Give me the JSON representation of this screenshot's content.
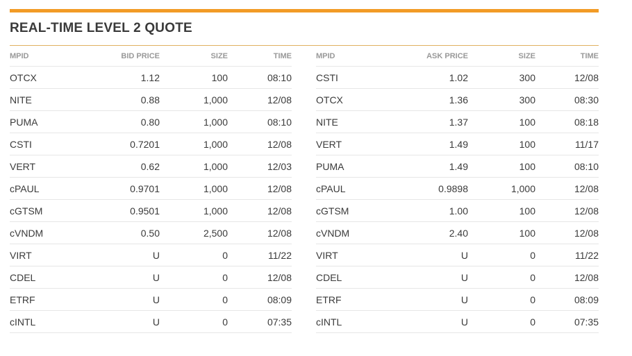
{
  "title": "REAL-TIME LEVEL 2 QUOTE",
  "colors": {
    "accent": "#f29b26",
    "rule": "#e0b060",
    "header_text": "#999999",
    "body_text": "#3a3a3a",
    "row_border": "#e6e6e6"
  },
  "bid": {
    "columns": [
      "MPID",
      "BID PRICE",
      "SIZE",
      "TIME"
    ],
    "rows": [
      {
        "mpid": "OTCX",
        "price": "1.12",
        "size": "100",
        "time": "08:10"
      },
      {
        "mpid": "NITE",
        "price": "0.88",
        "size": "1,000",
        "time": "12/08"
      },
      {
        "mpid": "PUMA",
        "price": "0.80",
        "size": "1,000",
        "time": "08:10"
      },
      {
        "mpid": "CSTI",
        "price": "0.7201",
        "size": "1,000",
        "time": "12/08"
      },
      {
        "mpid": "VERT",
        "price": "0.62",
        "size": "1,000",
        "time": "12/03"
      },
      {
        "mpid": "cPAUL",
        "price": "0.9701",
        "size": "1,000",
        "time": "12/08"
      },
      {
        "mpid": "cGTSM",
        "price": "0.9501",
        "size": "1,000",
        "time": "12/08"
      },
      {
        "mpid": "cVNDM",
        "price": "0.50",
        "size": "2,500",
        "time": "12/08"
      },
      {
        "mpid": "VIRT",
        "price": "U",
        "size": "0",
        "time": "11/22"
      },
      {
        "mpid": "CDEL",
        "price": "U",
        "size": "0",
        "time": "12/08"
      },
      {
        "mpid": "ETRF",
        "price": "U",
        "size": "0",
        "time": "08:09"
      },
      {
        "mpid": "cINTL",
        "price": "U",
        "size": "0",
        "time": "07:35"
      }
    ]
  },
  "ask": {
    "columns": [
      "MPID",
      "ASK PRICE",
      "SIZE",
      "TIME"
    ],
    "rows": [
      {
        "mpid": "CSTI",
        "price": "1.02",
        "size": "300",
        "time": "12/08"
      },
      {
        "mpid": "OTCX",
        "price": "1.36",
        "size": "300",
        "time": "08:30"
      },
      {
        "mpid": "NITE",
        "price": "1.37",
        "size": "100",
        "time": "08:18"
      },
      {
        "mpid": "VERT",
        "price": "1.49",
        "size": "100",
        "time": "11/17"
      },
      {
        "mpid": "PUMA",
        "price": "1.49",
        "size": "100",
        "time": "08:10"
      },
      {
        "mpid": "cPAUL",
        "price": "0.9898",
        "size": "1,000",
        "time": "12/08"
      },
      {
        "mpid": "cGTSM",
        "price": "1.00",
        "size": "100",
        "time": "12/08"
      },
      {
        "mpid": "cVNDM",
        "price": "2.40",
        "size": "100",
        "time": "12/08"
      },
      {
        "mpid": "VIRT",
        "price": "U",
        "size": "0",
        "time": "11/22"
      },
      {
        "mpid": "CDEL",
        "price": "U",
        "size": "0",
        "time": "12/08"
      },
      {
        "mpid": "ETRF",
        "price": "U",
        "size": "0",
        "time": "08:09"
      },
      {
        "mpid": "cINTL",
        "price": "U",
        "size": "0",
        "time": "07:35"
      }
    ]
  }
}
